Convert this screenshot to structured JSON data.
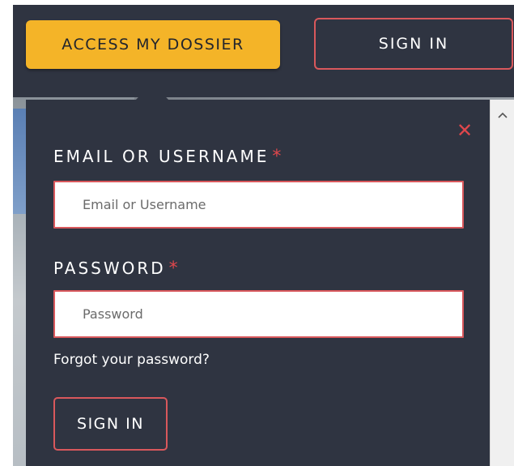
{
  "header": {
    "access_button_label": "ACCESS MY DOSSIER",
    "signin_button_label": "SIGN IN"
  },
  "login_panel": {
    "close_icon": "close-icon",
    "email_label": "EMAIL OR USERNAME",
    "email_required_mark": "*",
    "email_placeholder": "Email or Username",
    "email_value": "",
    "password_label": "PASSWORD",
    "password_required_mark": "*",
    "password_placeholder": "Password",
    "password_value": "",
    "forgot_link": "Forgot your password?",
    "submit_label": "SIGN IN"
  },
  "scrollbar": {
    "up_arrow_icon": "chevron-up-icon"
  },
  "colors": {
    "panel_bg": "#2f3441",
    "accent_yellow": "#f4b428",
    "accent_red": "#d9585c",
    "required_red": "#e0474c"
  }
}
